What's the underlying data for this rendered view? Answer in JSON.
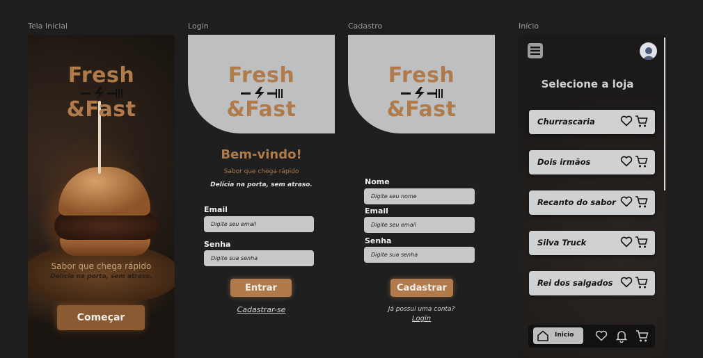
{
  "frames": {
    "splash": "Tela Inicial",
    "login": "Login",
    "signup": "Cadastro",
    "home": "Início"
  },
  "brand": {
    "line1": "Fresh",
    "line2": "&Fast",
    "color": "#b07a4a"
  },
  "splash": {
    "subtitle": "Sabor que chega rápido",
    "tagline": "Delícia na porta, sem atraso.",
    "start_label": "Começar"
  },
  "login": {
    "welcome": "Bem-vindo!",
    "subtitle": "Sabor que chega rápido",
    "tagline": "Delícia na porta, sem atraso.",
    "email_label": "Email",
    "email_placeholder": "Digite seu email",
    "password_label": "Senha",
    "password_placeholder": "Digite sua senha",
    "submit_label": "Entrar",
    "signup_link": "Cadastrar-se"
  },
  "signup": {
    "name_label": "Nome",
    "name_placeholder": "Digite seu nome",
    "email_label": "Email",
    "email_placeholder": "Digite seu email",
    "password_label": "Senha",
    "password_placeholder": "Digite sua senha",
    "submit_label": "Cadastrar",
    "have_account": "Já possui uma conta?",
    "login_link": "Login"
  },
  "home": {
    "title": "Selecione a loja",
    "stores": [
      {
        "name": "Churrascaria"
      },
      {
        "name": "Dois irmãos"
      },
      {
        "name": "Recanto do sabor"
      },
      {
        "name": "Silva Truck"
      },
      {
        "name": "Rei dos salgados"
      }
    ],
    "nav": {
      "home_label": "Inicio"
    }
  }
}
